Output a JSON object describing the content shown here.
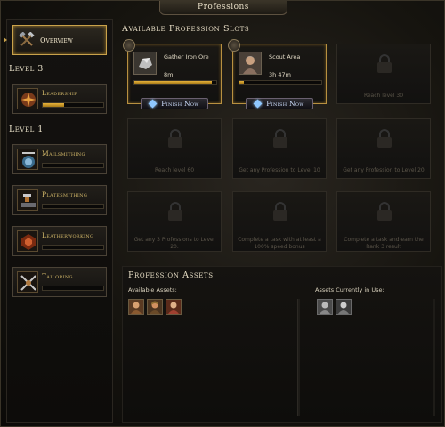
{
  "window": {
    "title": "Professions"
  },
  "sidebar": {
    "overview_label": "Overview",
    "groups": [
      {
        "level_label": "Level 3",
        "items": [
          {
            "label": "Leadership",
            "progress": 0.35,
            "icon": "leadership-icon"
          }
        ]
      },
      {
        "level_label": "Level 1",
        "items": [
          {
            "label": "Mailsmithing",
            "progress": 0.0,
            "icon": "mailsmithing-icon"
          },
          {
            "label": "Platesmithing",
            "progress": 0.0,
            "icon": "platesmithing-icon"
          },
          {
            "label": "Leatherworking",
            "progress": 0.0,
            "icon": "leatherworking-icon"
          },
          {
            "label": "Tailoring",
            "progress": 0.0,
            "icon": "tailoring-icon"
          }
        ]
      }
    ]
  },
  "slots": {
    "title": "Available Profession Slots",
    "active": [
      {
        "name": "Gather Iron Ore",
        "time": "8m",
        "progress": 0.95,
        "button": "Finish Now"
      },
      {
        "name": "Scout Area",
        "time": "3h 47m",
        "progress": 0.05,
        "button": "Finish Now"
      }
    ],
    "locked": [
      "Reach level 30",
      "Reach level 60",
      "Get any Profession to Level 10",
      "Get any Profession to Level 20",
      "Get any 3 Professions to Level 20.",
      "Complete a task with at least a 100% speed bonus",
      "Complete a task and earn the Rank 3 result"
    ]
  },
  "assets": {
    "title": "Profession Assets",
    "available_label": "Available Assets:",
    "in_use_label": "Assets Currently in Use:",
    "available_count": 3,
    "in_use_count": 2
  },
  "colors": {
    "accent_gold": "#c9a24b",
    "progress_gold": "#e8b33c",
    "finish_text": "#cfe0ff"
  }
}
